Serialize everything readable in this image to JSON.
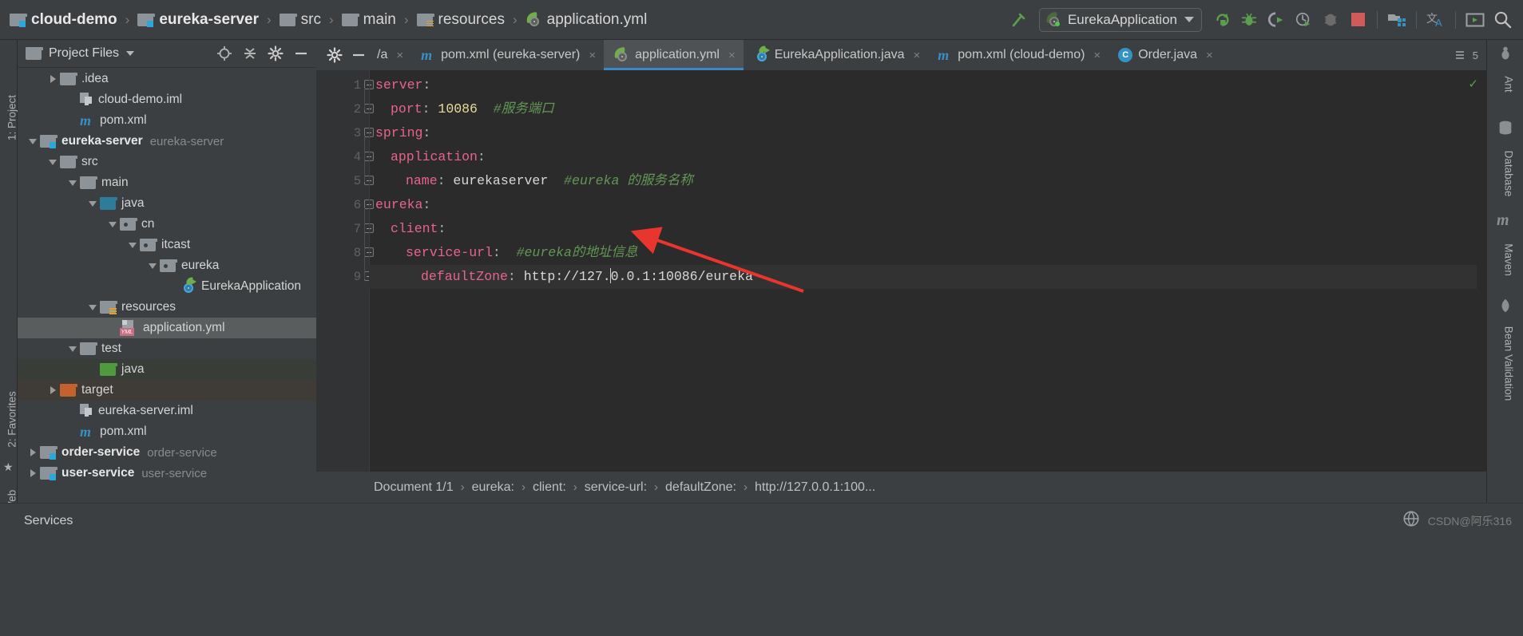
{
  "navbar": {
    "breadcrumbs": [
      {
        "label": "cloud-demo",
        "icon": "module-folder-icon",
        "bold": true
      },
      {
        "label": "eureka-server",
        "icon": "module-folder-icon",
        "bold": true
      },
      {
        "label": "src",
        "icon": "folder-icon",
        "bold": false
      },
      {
        "label": "main",
        "icon": "folder-icon",
        "bold": false
      },
      {
        "label": "resources",
        "icon": "resources-folder-icon",
        "bold": false
      },
      {
        "label": "application.yml",
        "icon": "spring-yaml-icon",
        "bold": false
      }
    ],
    "separator": "›",
    "run_config": {
      "label": "EurekaApplication",
      "icon": "spring-boot-icon",
      "dropdown": "▾"
    },
    "tools": [
      {
        "name": "build-hammer-icon"
      },
      {
        "name": "run-icon"
      },
      {
        "name": "debug-icon"
      },
      {
        "name": "run-with-coverage-icon"
      },
      {
        "name": "profiler-icon"
      },
      {
        "name": "stop-icon"
      },
      {
        "name": "project-structure-icon"
      },
      {
        "name": "translate-icon"
      },
      {
        "name": "presentation-icon"
      },
      {
        "name": "search-icon"
      }
    ]
  },
  "left_strip": {
    "labels": [
      "1: Project",
      "2: Favorites",
      "Web"
    ]
  },
  "right_strip": {
    "labels": [
      "Ant",
      "Database",
      "Maven",
      "Bean Validation"
    ]
  },
  "project_panel": {
    "title": "Project Files",
    "dropdown": "▾",
    "tools": [
      {
        "name": "locate-target-icon"
      },
      {
        "name": "collapse-all-icon"
      },
      {
        "name": "settings-gear-icon"
      },
      {
        "name": "hide-panel-icon"
      }
    ],
    "tree": [
      {
        "label": ".idea",
        "sub": "",
        "indent": 1,
        "twisty": "closed",
        "icon": "folder-icon",
        "bold": false,
        "state": "none"
      },
      {
        "label": "cloud-demo.iml",
        "sub": "",
        "indent": 2,
        "twisty": "none",
        "icon": "iml-file-icon",
        "bold": false,
        "state": "none"
      },
      {
        "label": "pom.xml",
        "sub": "",
        "indent": 2,
        "twisty": "none",
        "icon": "maven-m-icon",
        "bold": false,
        "state": "none"
      },
      {
        "label": "eureka-server",
        "sub": "eureka-server",
        "indent": 0,
        "twisty": "open",
        "icon": "module-folder-icon",
        "bold": true,
        "state": "none"
      },
      {
        "label": "src",
        "sub": "",
        "indent": 1,
        "twisty": "open",
        "icon": "folder-icon",
        "bold": false,
        "state": "none"
      },
      {
        "label": "main",
        "sub": "",
        "indent": 2,
        "twisty": "open",
        "icon": "folder-icon",
        "bold": false,
        "state": "none"
      },
      {
        "label": "java",
        "sub": "",
        "indent": 3,
        "twisty": "open",
        "icon": "source-root-icon",
        "bold": false,
        "state": "none"
      },
      {
        "label": "cn",
        "sub": "",
        "indent": 4,
        "twisty": "open",
        "icon": "package-icon",
        "bold": false,
        "state": "none"
      },
      {
        "label": "itcast",
        "sub": "",
        "indent": 5,
        "twisty": "open",
        "icon": "package-icon",
        "bold": false,
        "state": "none"
      },
      {
        "label": "eureka",
        "sub": "",
        "indent": 6,
        "twisty": "open",
        "icon": "package-icon",
        "bold": false,
        "state": "none"
      },
      {
        "label": "EurekaApplication",
        "sub": "",
        "indent": 7,
        "twisty": "none",
        "icon": "spring-boot-class-icon",
        "bold": false,
        "state": "none"
      },
      {
        "label": "resources",
        "sub": "",
        "indent": 3,
        "twisty": "open",
        "icon": "resources-folder-icon",
        "bold": false,
        "state": "none"
      },
      {
        "label": "application.yml",
        "sub": "",
        "indent": 4,
        "twisty": "none",
        "icon": "yml-file-icon",
        "bold": false,
        "state": "selected"
      },
      {
        "label": "test",
        "sub": "",
        "indent": 2,
        "twisty": "open",
        "icon": "folder-icon",
        "bold": false,
        "state": "none"
      },
      {
        "label": "java",
        "sub": "",
        "indent": 3,
        "twisty": "none",
        "icon": "test-root-icon",
        "bold": false,
        "state": "test"
      },
      {
        "label": "target",
        "sub": "",
        "indent": 1,
        "twisty": "closed",
        "icon": "excluded-folder-icon",
        "bold": false,
        "state": "target"
      },
      {
        "label": "eureka-server.iml",
        "sub": "",
        "indent": 2,
        "twisty": "none",
        "icon": "iml-file-icon",
        "bold": false,
        "state": "none"
      },
      {
        "label": "pom.xml",
        "sub": "",
        "indent": 2,
        "twisty": "none",
        "icon": "maven-m-icon",
        "bold": false,
        "state": "none"
      },
      {
        "label": "order-service",
        "sub": "order-service",
        "indent": 0,
        "twisty": "closed",
        "icon": "module-folder-icon",
        "bold": true,
        "state": "none"
      },
      {
        "label": "user-service",
        "sub": "user-service",
        "indent": 0,
        "twisty": "closed",
        "icon": "module-folder-icon",
        "bold": true,
        "state": "none"
      }
    ]
  },
  "editor_tabs": {
    "tools": [
      {
        "name": "settings-gear-icon"
      },
      {
        "name": "hide-editor-icon"
      }
    ],
    "tabs": [
      {
        "label": "/a",
        "icon": "clipped-tab-icon",
        "active": false,
        "close": "×"
      },
      {
        "label": "pom.xml (eureka-server)",
        "icon": "maven-m-icon",
        "active": false,
        "close": "×"
      },
      {
        "label": "application.yml",
        "icon": "spring-yaml-icon",
        "active": true,
        "close": "×"
      },
      {
        "label": "EurekaApplication.java",
        "icon": "spring-boot-class-icon",
        "active": false,
        "close": "×"
      },
      {
        "label": "pom.xml (cloud-demo)",
        "icon": "maven-m-icon",
        "active": false,
        "close": "×"
      },
      {
        "label": "Order.java",
        "icon": "java-class-icon",
        "active": false,
        "close": "×"
      }
    ],
    "overflow_label": "5"
  },
  "editor": {
    "line_numbers": [
      "1",
      "2",
      "3",
      "4",
      "5",
      "6",
      "7",
      "8",
      "9"
    ],
    "lines": [
      {
        "n": 1,
        "indent": 0,
        "key": "server",
        "colon": ":",
        "value": "",
        "comment": "",
        "fold": "open"
      },
      {
        "n": 2,
        "indent": 1,
        "key": "port",
        "colon": ":",
        "value": "10086",
        "value_type": "num",
        "comment": "#服务端口",
        "fold": "leaf"
      },
      {
        "n": 3,
        "indent": 0,
        "key": "spring",
        "colon": ":",
        "value": "",
        "comment": "",
        "fold": "open"
      },
      {
        "n": 4,
        "indent": 1,
        "key": "application",
        "colon": ":",
        "value": "",
        "comment": "",
        "fold": "open"
      },
      {
        "n": 5,
        "indent": 2,
        "key": "name",
        "colon": ":",
        "value": "eurekaserver",
        "comment": "#eureka 的服务名称",
        "fold": "leaf"
      },
      {
        "n": 6,
        "indent": 0,
        "key": "eureka",
        "colon": ":",
        "value": "",
        "comment": "",
        "fold": "open"
      },
      {
        "n": 7,
        "indent": 1,
        "key": "client",
        "colon": ":",
        "value": "",
        "comment": "",
        "fold": "open"
      },
      {
        "n": 8,
        "indent": 2,
        "key": "service-url",
        "colon": ":",
        "value": "",
        "comment": "#eureka的地址信息",
        "fold": "open"
      },
      {
        "n": 9,
        "indent": 3,
        "key": "defaultZone",
        "colon": ":",
        "value": "http://127.0.0.1:10086/eureka",
        "comment": "",
        "fold": "leaf"
      }
    ],
    "caret_line": 9,
    "inspection_status": "✓"
  },
  "doc_breadcrumb": {
    "items": [
      "Document 1/1",
      "eureka:",
      "client:",
      "service-url:",
      "defaultZone:",
      "http://127.0.0.1:100..."
    ],
    "separator": "›"
  },
  "bottom_bar": {
    "services_label": "Services",
    "watermark": "CSDN@阿乐316",
    "globe_icon": "globe-icon"
  },
  "colors": {
    "accent_blue": "#3a88c8",
    "key_pink": "#e8648c",
    "comment_green": "#629755",
    "number_yellow": "#e8dd9b",
    "annotation_red": "#e8352e",
    "editor_bg": "#2b2b2b",
    "panel_bg": "#3c3f41"
  }
}
